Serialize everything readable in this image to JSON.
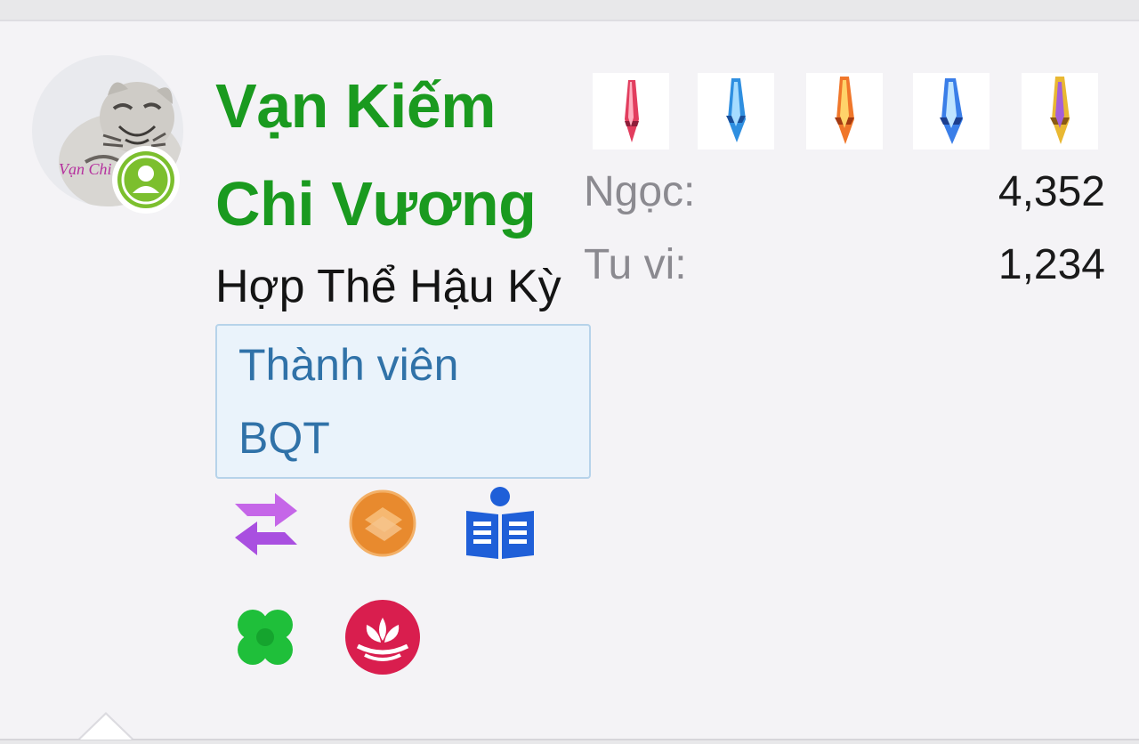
{
  "profile": {
    "name_line1": "Vạn Kiếm",
    "name_line2": "Chi Vương",
    "rank": "Hợp Thể Hậu Kỳ",
    "avatar_watermark": "Vạn Chi",
    "groups": [
      "Thành viên",
      "BQT"
    ]
  },
  "stats": [
    {
      "label": "Ngọc:",
      "value": "4,352"
    },
    {
      "label": "Tu vi:",
      "value": "1,234"
    }
  ],
  "weapons": [
    "red-sword-icon",
    "blue-sword-icon",
    "flame-sword-icon",
    "ice-sword-icon",
    "gold-sword-icon"
  ],
  "badges": [
    "exchange-arrows-icon",
    "orange-coin-icon",
    "reader-book-icon",
    "four-leaf-clover-icon",
    "lotus-icon"
  ],
  "colors": {
    "name": "#1a9a1f",
    "group_text": "#3072a8",
    "group_bg": "#eaf3fb",
    "online": "#7cbf2e",
    "label": "#8b8a90"
  }
}
